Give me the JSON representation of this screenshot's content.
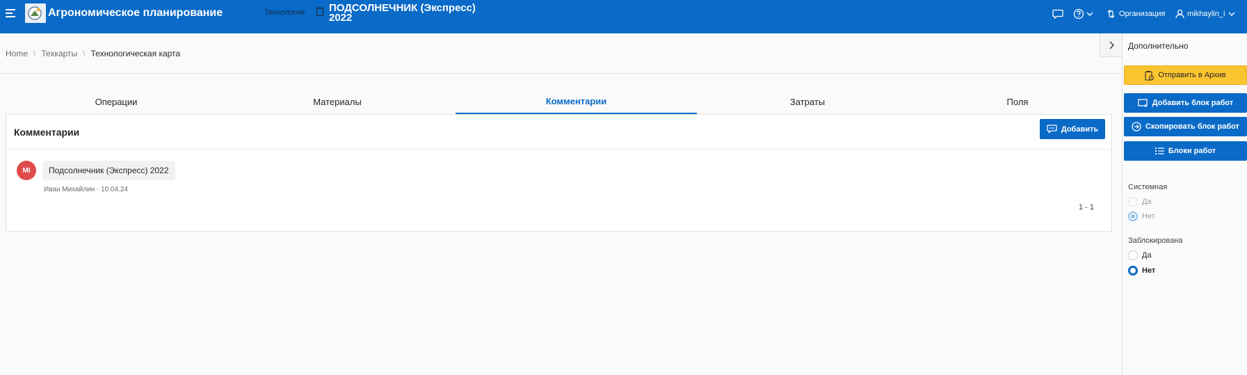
{
  "header": {
    "app_title": "Агрономическое планирование",
    "nav_tech": "Технология",
    "doc_title_line1": "ПОДСОЛНЕЧНИК (Экспресс)",
    "doc_title_line2": "2022",
    "org_label": "Организация",
    "user_label": "mikhaylin_i"
  },
  "breadcrumb": {
    "home": "Home",
    "techcards": "Техкарты",
    "current": "Технологическая карта"
  },
  "tabs": [
    {
      "label": "Операции"
    },
    {
      "label": "Материалы"
    },
    {
      "label": "Комментарии"
    },
    {
      "label": "Затраты"
    },
    {
      "label": "Поля"
    }
  ],
  "comments_card": {
    "title": "Комментарии",
    "add_button": "Добавить",
    "comment": {
      "initials": "MI",
      "text": "Подсолнечник (Экспресс) 2022",
      "meta": "Иван Михайлин · 10.04.24"
    },
    "pagination": "1 - 1"
  },
  "right_panel": {
    "title": "Дополнительно",
    "archive_button": "Отправить в Архив",
    "add_block_button": "Добавить блок работ",
    "copy_block_button": "Скопировать блок работ",
    "blocks_button": "Блоки работ",
    "system": {
      "label": "Системная",
      "yes": "Да",
      "no": "Нет"
    },
    "locked": {
      "label": "Заблокирована",
      "yes": "Да",
      "no": "Нет"
    }
  },
  "colors": {
    "brand": "#0a6ac7",
    "archive_yellow": "#fbc532",
    "avatar_red": "#e04b4b"
  }
}
